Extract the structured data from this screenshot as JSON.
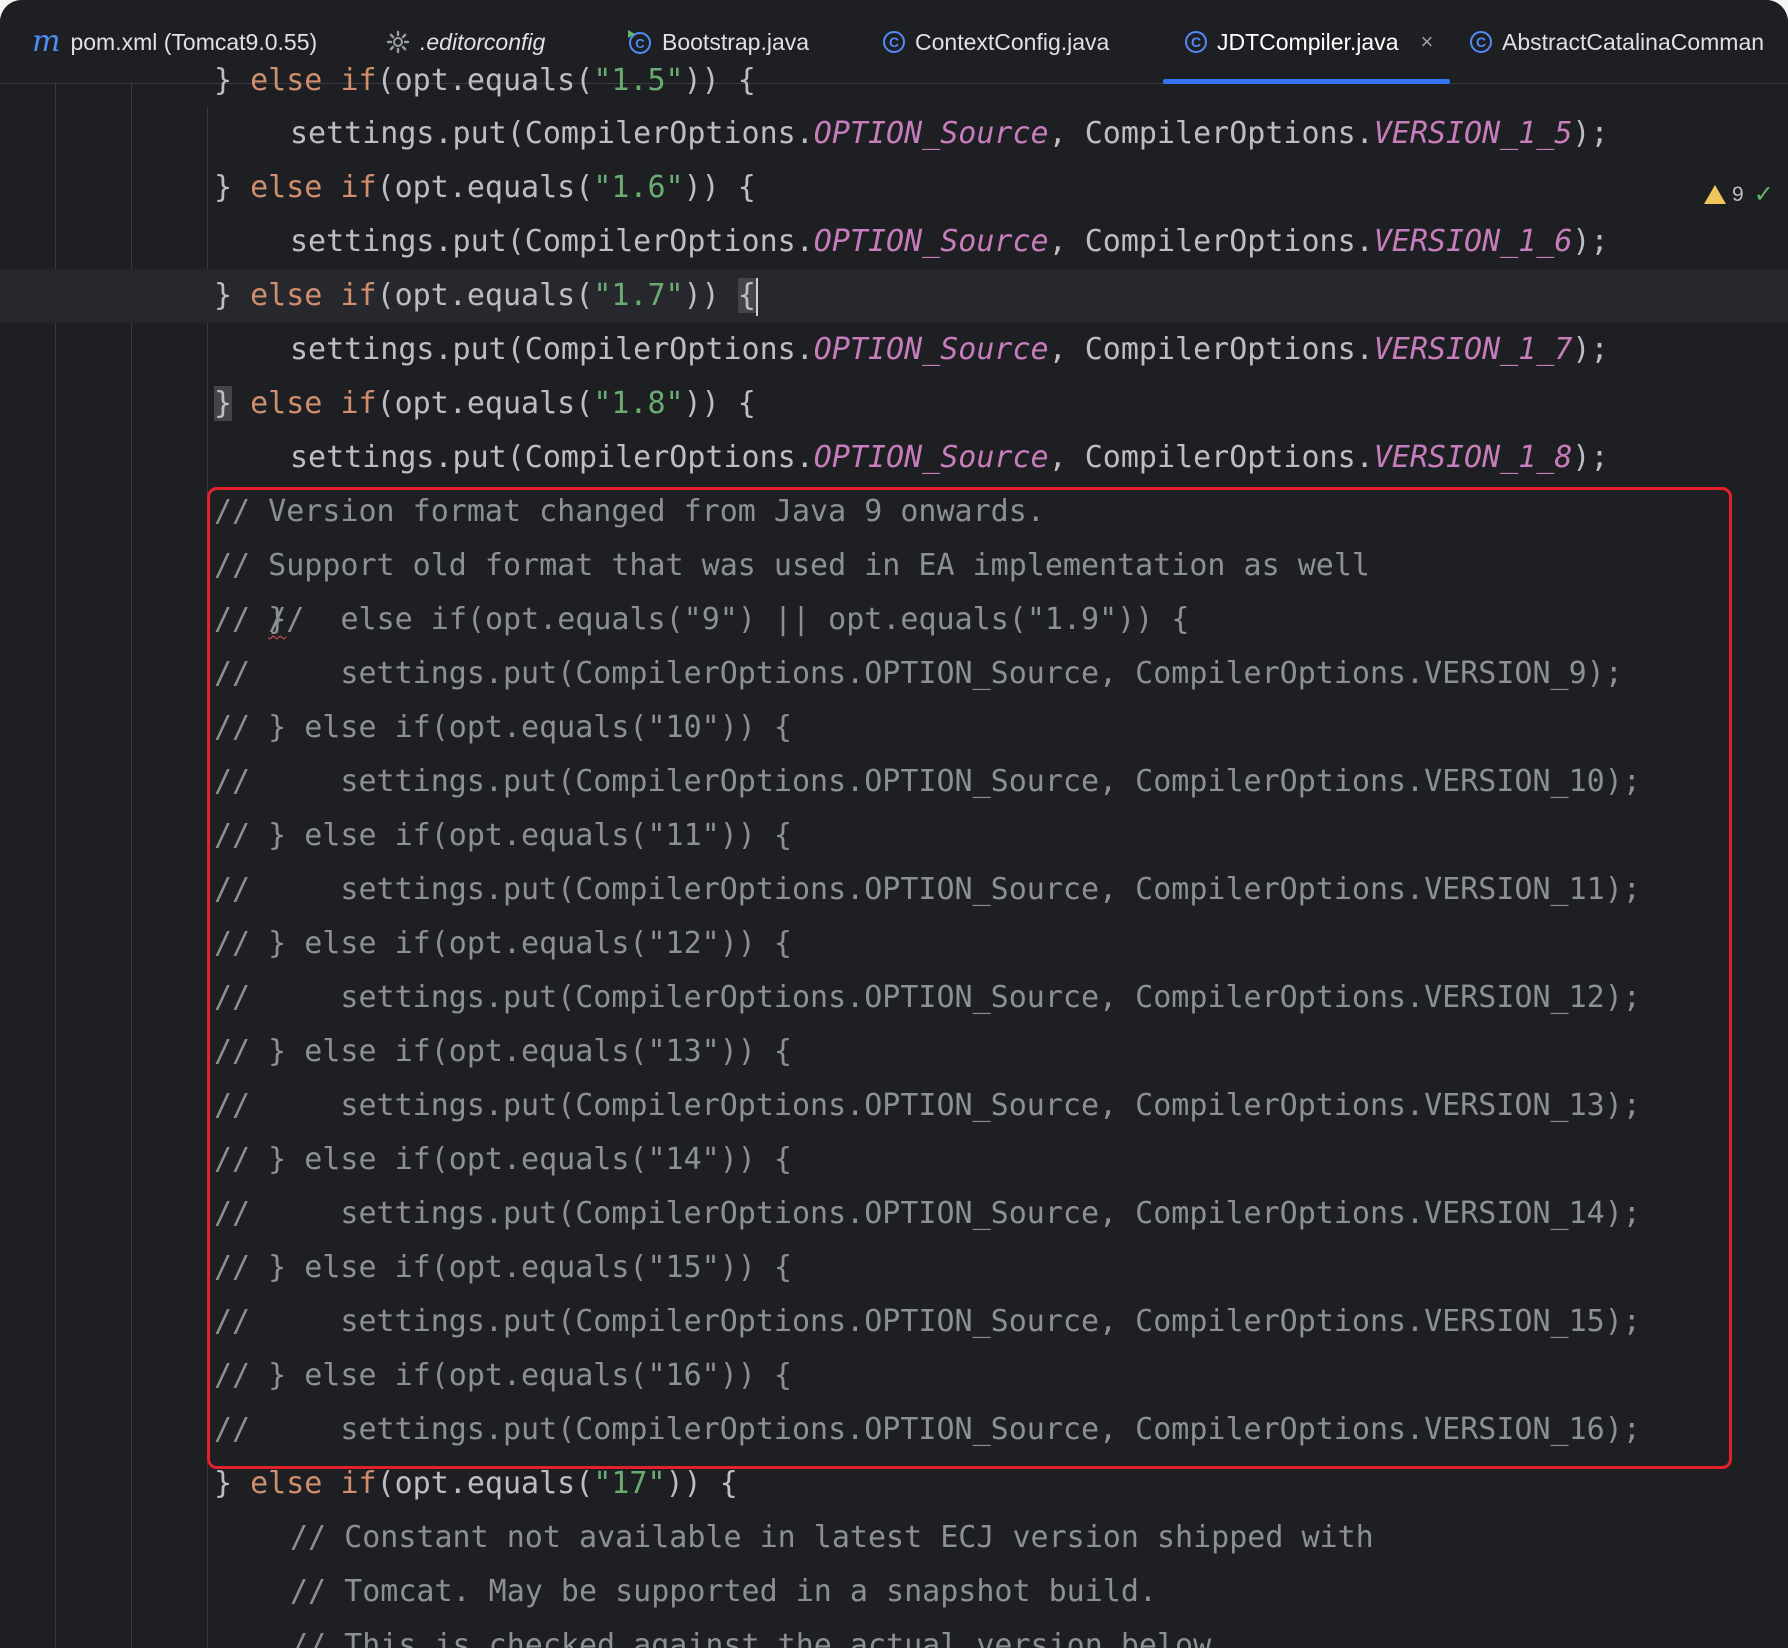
{
  "tabs": [
    {
      "icon": "maven-icon",
      "label": "pom.xml (Tomcat9.0.55)"
    },
    {
      "icon": "gear-icon",
      "label": ".editorconfig"
    },
    {
      "icon": "java-class-run-icon",
      "label": "Bootstrap.java"
    },
    {
      "icon": "java-class-icon",
      "label": "ContextConfig.java"
    },
    {
      "icon": "java-class-icon",
      "label": "JDTCompiler.java",
      "active": true,
      "close": "×"
    },
    {
      "icon": "java-class-icon",
      "label": "AbstractCatalinaComman"
    }
  ],
  "inspection": {
    "warnings": "9"
  },
  "code": {
    "l0": {
      "a": "} ",
      "b": "else ",
      "c": "if",
      "d": "(opt.equals(",
      "e": "\"1.5\"",
      "f": ")) {"
    },
    "l1": {
      "a": "settings.put(CompilerOptions.",
      "b": "OPTION_Source",
      ",": ", CompilerOptions.",
      "c": "VERSION_1_5",
      "d": ");"
    },
    "l2": {
      "a": "} ",
      "b": "else ",
      "c": "if",
      "d": "(opt.equals(",
      "e": "\"1.6\"",
      "f": ")) {"
    },
    "l3": {
      "a": "settings.put(CompilerOptions.",
      "b": "OPTION_Source",
      ",": ", CompilerOptions.",
      "c": "VERSION_1_6",
      "d": ");"
    },
    "l4": {
      "a": "} ",
      "b": "else ",
      "c": "if",
      "d": "(opt.equals(",
      "e": "\"1.7\"",
      "f": ")) ",
      "g": "{"
    },
    "l5": {
      "a": "settings.put(CompilerOptions.",
      "b": "OPTION_Source",
      ",": ", CompilerOptions.",
      "c": "VERSION_1_7",
      "d": ");"
    },
    "l6": {
      "a": "}",
      "b": " else ",
      "c": "if",
      "d": "(opt.equals(",
      "e": "\"1.8\"",
      "f": ")) {"
    },
    "l7": {
      "a": "settings.put(CompilerOptions.",
      "b": "OPTION_Source",
      ",": ", CompilerOptions.",
      "c": "VERSION_1_8",
      "d": ");"
    },
    "comments": [
      "// Version format changed from Java 9 onwards.",
      "// Support old format that was used in EA implementation as well",
      "//  else if(opt.equals(\"9\") || opt.equals(\"1.9\")) {",
      "//     settings.put(CompilerOptions.OPTION_Source, CompilerOptions.VERSION_9);",
      "// } else if(opt.equals(\"10\")) {",
      "//     settings.put(CompilerOptions.OPTION_Source, CompilerOptions.VERSION_10);",
      "// } else if(opt.equals(\"11\")) {",
      "//     settings.put(CompilerOptions.OPTION_Source, CompilerOptions.VERSION_11);",
      "// } else if(opt.equals(\"12\")) {",
      "//     settings.put(CompilerOptions.OPTION_Source, CompilerOptions.VERSION_12);",
      "// } else if(opt.equals(\"13\")) {",
      "//     settings.put(CompilerOptions.OPTION_Source, CompilerOptions.VERSION_13);",
      "// } else if(opt.equals(\"14\")) {",
      "//     settings.put(CompilerOptions.OPTION_Source, CompilerOptions.VERSION_14);",
      "// } else if(opt.equals(\"15\")) {",
      "//     settings.put(CompilerOptions.OPTION_Source, CompilerOptions.VERSION_15);",
      "// } else if(opt.equals(\"16\")) {",
      "//     settings.put(CompilerOptions.OPTION_Source, CompilerOptions.VERSION_16);"
    ],
    "squiggle_brace": "}",
    "l17": {
      "a": "} ",
      "b": "else ",
      "c": "if",
      "d": "(opt.equals(",
      "e": "\"17\"",
      "f": ")) {"
    },
    "l18": "// Constant not available in latest ECJ version shipped with",
    "l19": "// Tomcat. May be supported in a snapshot build.",
    "l20": "// This is checked against the actual version below."
  },
  "colors": {
    "keyword": "#cf8e6d",
    "string": "#6aab73",
    "constant": "#c77dbb",
    "comment": "#8c8f95",
    "highlight_box": "#e4202d",
    "active_tab": "#3574f0"
  }
}
